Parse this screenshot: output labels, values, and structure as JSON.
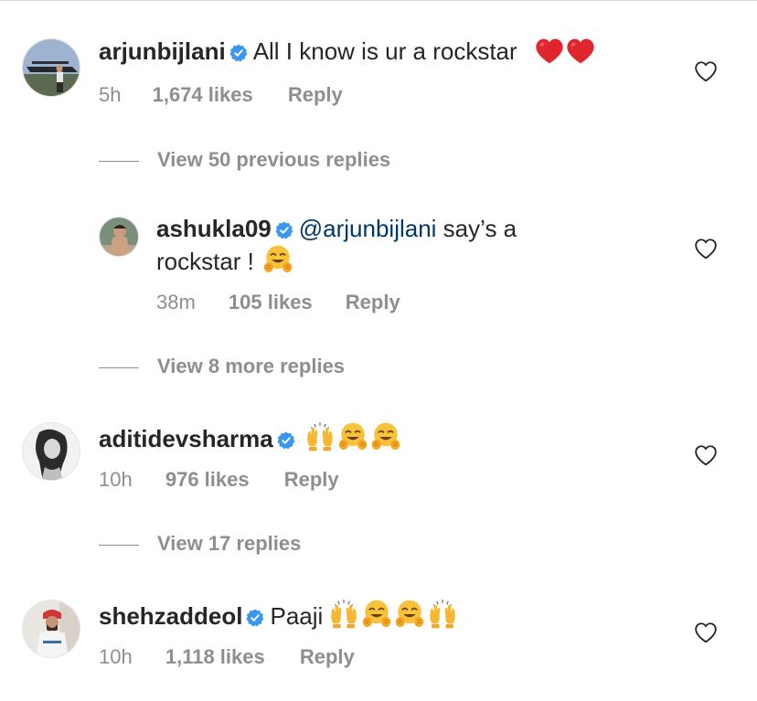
{
  "comments": [
    {
      "username": "arjunbijlani",
      "text": "All I know is ur a rockstar",
      "emojis": [
        "red-heart",
        "red-heart"
      ],
      "time": "5h",
      "likes": "1,674 likes",
      "reply_label": "Reply"
    },
    {
      "username": "ashukla09",
      "mention": "@arjunbijlani",
      "text_line1": " say’s a",
      "text_line2": "rockstar ! ",
      "emojis": [
        "hugging-face"
      ],
      "time": "38m",
      "likes": "105 likes",
      "reply_label": "Reply"
    },
    {
      "username": "aditidevsharma",
      "text": "",
      "emojis": [
        "raising-hands",
        "hugging-face",
        "hugging-face"
      ],
      "time": "10h",
      "likes": "976 likes",
      "reply_label": "Reply"
    },
    {
      "username": "shehzaddeol",
      "text": "Paaji",
      "emojis": [
        "raising-hands",
        "hugging-face",
        "hugging-face",
        "raising-hands"
      ],
      "time": "10h",
      "likes": "1,118 likes",
      "reply_label": "Reply"
    }
  ],
  "view_replies": [
    "View 50 previous replies",
    "View 8 more replies",
    "View 17 replies"
  ],
  "colors": {
    "text": "#262626",
    "muted": "#8e8e8e",
    "mention": "#00376b",
    "verified": "#3897f0"
  }
}
